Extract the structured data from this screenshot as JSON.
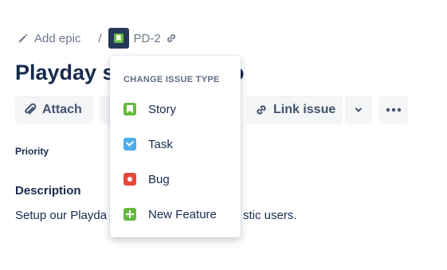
{
  "breadcrumb": {
    "add_epic_label": "Add epic",
    "separator": "/",
    "issue_key": "PD-2"
  },
  "issue": {
    "title_start": "Playday su",
    "title_end": "o"
  },
  "toolbar": {
    "attach_label": "Attach",
    "link_issue_label": "Link issue"
  },
  "fields": {
    "priority_label": "Priority"
  },
  "description": {
    "heading": "Description",
    "text_start": "Setup our Playda",
    "text_end": "stic users."
  },
  "dropdown": {
    "heading": "CHANGE ISSUE TYPE",
    "items": [
      {
        "label": "Story",
        "icon": "story-icon",
        "color": "#63ba3c"
      },
      {
        "label": "Task",
        "icon": "task-icon",
        "color": "#4bade8"
      },
      {
        "label": "Bug",
        "icon": "bug-icon",
        "color": "#e5493a"
      },
      {
        "label": "New Feature",
        "icon": "new-feature-icon",
        "color": "#63ba3c"
      }
    ]
  },
  "colors": {
    "text_primary": "#172b4d",
    "text_subtle": "#6b778c",
    "button_bg": "#f4f5f7",
    "type_button_bg": "#253858"
  }
}
